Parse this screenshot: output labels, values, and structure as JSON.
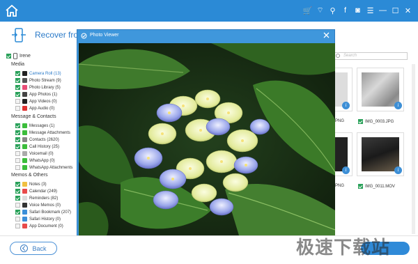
{
  "header": {
    "title": "Recover from"
  },
  "device": {
    "name": "Irene"
  },
  "sections": [
    {
      "title": "Media",
      "items": [
        {
          "label": "Camera Roll (13)",
          "checked": true,
          "active": true,
          "icon": "camera-roll-icon",
          "color": "#222222"
        },
        {
          "label": "Photo Stream (9)",
          "checked": true,
          "icon": "photo-stream-icon",
          "color": "#555555"
        },
        {
          "label": "Photo Library (5)",
          "checked": true,
          "icon": "photo-library-icon",
          "color": "#e94e77"
        },
        {
          "label": "App Photos (1)",
          "checked": true,
          "icon": "app-photos-icon",
          "color": "#444444"
        },
        {
          "label": "App Videos (0)",
          "checked": false,
          "icon": "app-videos-icon",
          "color": "#222222"
        },
        {
          "label": "App Audio (0)",
          "checked": false,
          "icon": "app-audio-icon",
          "color": "#e03333"
        }
      ]
    },
    {
      "title": "Message & Contacts",
      "items": [
        {
          "label": "Messages (1)",
          "checked": true,
          "icon": "messages-icon",
          "color": "#3bbd3b"
        },
        {
          "label": "Message Attachments",
          "checked": true,
          "icon": "message-attachments-icon",
          "color": "#3bbd3b"
        },
        {
          "label": "Contacts (2620)",
          "checked": true,
          "icon": "contacts-icon",
          "color": "#888888"
        },
        {
          "label": "Call History (25)",
          "checked": true,
          "icon": "call-history-icon",
          "color": "#3bbd3b"
        },
        {
          "label": "Voicemail (0)",
          "checked": false,
          "icon": "voicemail-icon",
          "color": "#aaaaaa"
        },
        {
          "label": "WhatsApp (0)",
          "checked": false,
          "icon": "whatsapp-icon",
          "color": "#3bbd3b"
        },
        {
          "label": "WhatsApp Attachments",
          "checked": false,
          "icon": "whatsapp-attachments-icon",
          "color": "#3bbd3b"
        }
      ]
    },
    {
      "title": "Memos & Others",
      "items": [
        {
          "label": "Notes (3)",
          "checked": true,
          "icon": "notes-icon",
          "color": "#f0c040"
        },
        {
          "label": "Calendar (249)",
          "checked": true,
          "icon": "calendar-icon",
          "color": "#e84a4a"
        },
        {
          "label": "Reminders (82)",
          "checked": true,
          "icon": "reminders-icon",
          "color": "#dddddd"
        },
        {
          "label": "Voice Memos (0)",
          "checked": false,
          "icon": "voice-memos-icon",
          "color": "#333333"
        },
        {
          "label": "Safari Bookmark (207)",
          "checked": true,
          "icon": "safari-bookmark-icon",
          "color": "#3b8fd8"
        },
        {
          "label": "Safari History (0)",
          "checked": false,
          "icon": "safari-history-icon",
          "color": "#3b8fd8"
        },
        {
          "label": "App Document (0)",
          "checked": false,
          "icon": "app-document-icon",
          "color": "#e84a4a"
        }
      ]
    }
  ],
  "search": {
    "placeholder": "Search"
  },
  "thumbnails": [
    {
      "caption": "PNG",
      "checked": false
    },
    {
      "caption": "IMG_0003.JPG",
      "checked": true
    },
    {
      "caption": "PNG",
      "checked": false
    },
    {
      "caption": "IMG_0011.MOV",
      "checked": true
    }
  ],
  "viewer": {
    "title": "Photo Viewer"
  },
  "footer": {
    "back_label": "Back",
    "watermark": "极速下载站"
  },
  "colors": {
    "accent": "#2b8ad6",
    "checkbox": "#2aa15a"
  }
}
